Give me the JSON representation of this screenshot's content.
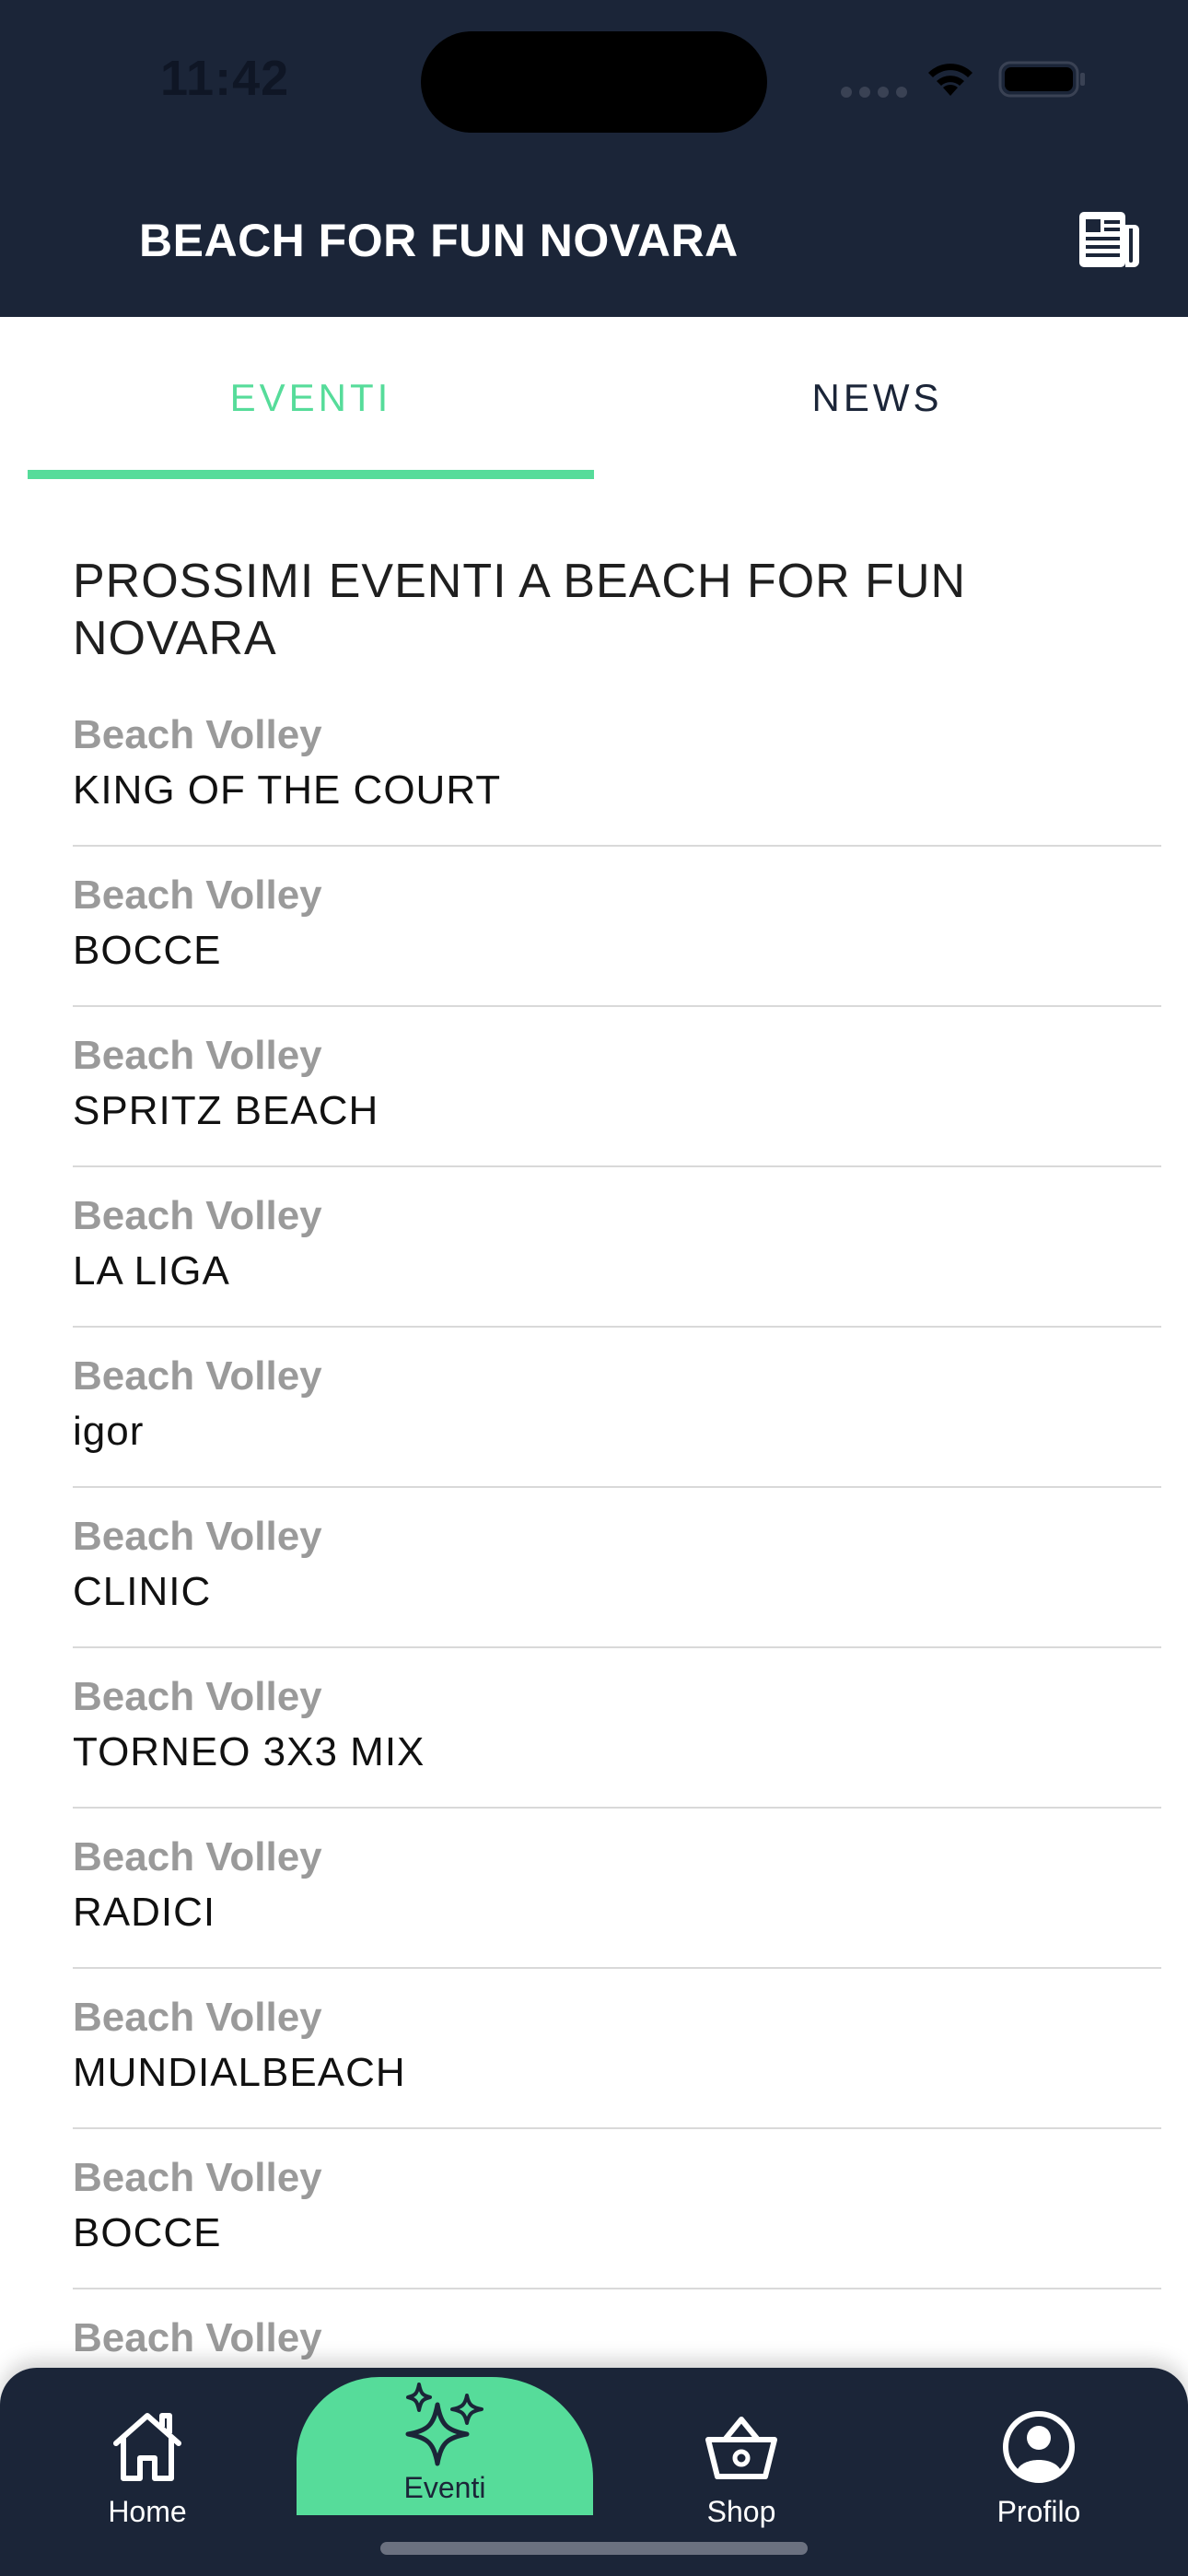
{
  "status_bar": {
    "time": "11:42",
    "wifi_icon": "wifi-icon",
    "battery_icon": "battery-icon"
  },
  "header": {
    "title": "BEACH FOR FUN NOVARA",
    "action_icon": "newspaper-icon"
  },
  "tabs": [
    {
      "label": "EVENTI",
      "active": true
    },
    {
      "label": "NEWS",
      "active": false
    }
  ],
  "content": {
    "section_title": "PROSSIMI EVENTI A BEACH FOR FUN NOVARA",
    "events": [
      {
        "category": "Beach Volley",
        "name": "KING OF THE COURT"
      },
      {
        "category": "Beach Volley",
        "name": "BOCCE"
      },
      {
        "category": "Beach Volley",
        "name": "SPRITZ BEACH"
      },
      {
        "category": "Beach Volley",
        "name": "LA LIGA"
      },
      {
        "category": "Beach Volley",
        "name": "igor"
      },
      {
        "category": "Beach Volley",
        "name": "CLINIC"
      },
      {
        "category": "Beach Volley",
        "name": "TORNEO 3X3 MIX"
      },
      {
        "category": "Beach Volley",
        "name": "RADICI"
      },
      {
        "category": "Beach Volley",
        "name": "MUNDIALBEACH"
      },
      {
        "category": "Beach Volley",
        "name": "BOCCE"
      },
      {
        "category": "Beach Volley",
        "name": ""
      }
    ]
  },
  "bottom_nav": {
    "items": [
      {
        "label": "Home",
        "icon": "home-icon",
        "active": false
      },
      {
        "label": "Eventi",
        "icon": "sparkles-icon",
        "active": true
      },
      {
        "label": "Shop",
        "icon": "basket-icon",
        "active": false
      },
      {
        "label": "Profilo",
        "icon": "user-circle-icon",
        "active": false
      }
    ]
  },
  "colors": {
    "header_bg": "#1b2538",
    "accent": "#56dc9a",
    "category_text": "#9a9a9a",
    "divider": "#d9d9d9"
  }
}
